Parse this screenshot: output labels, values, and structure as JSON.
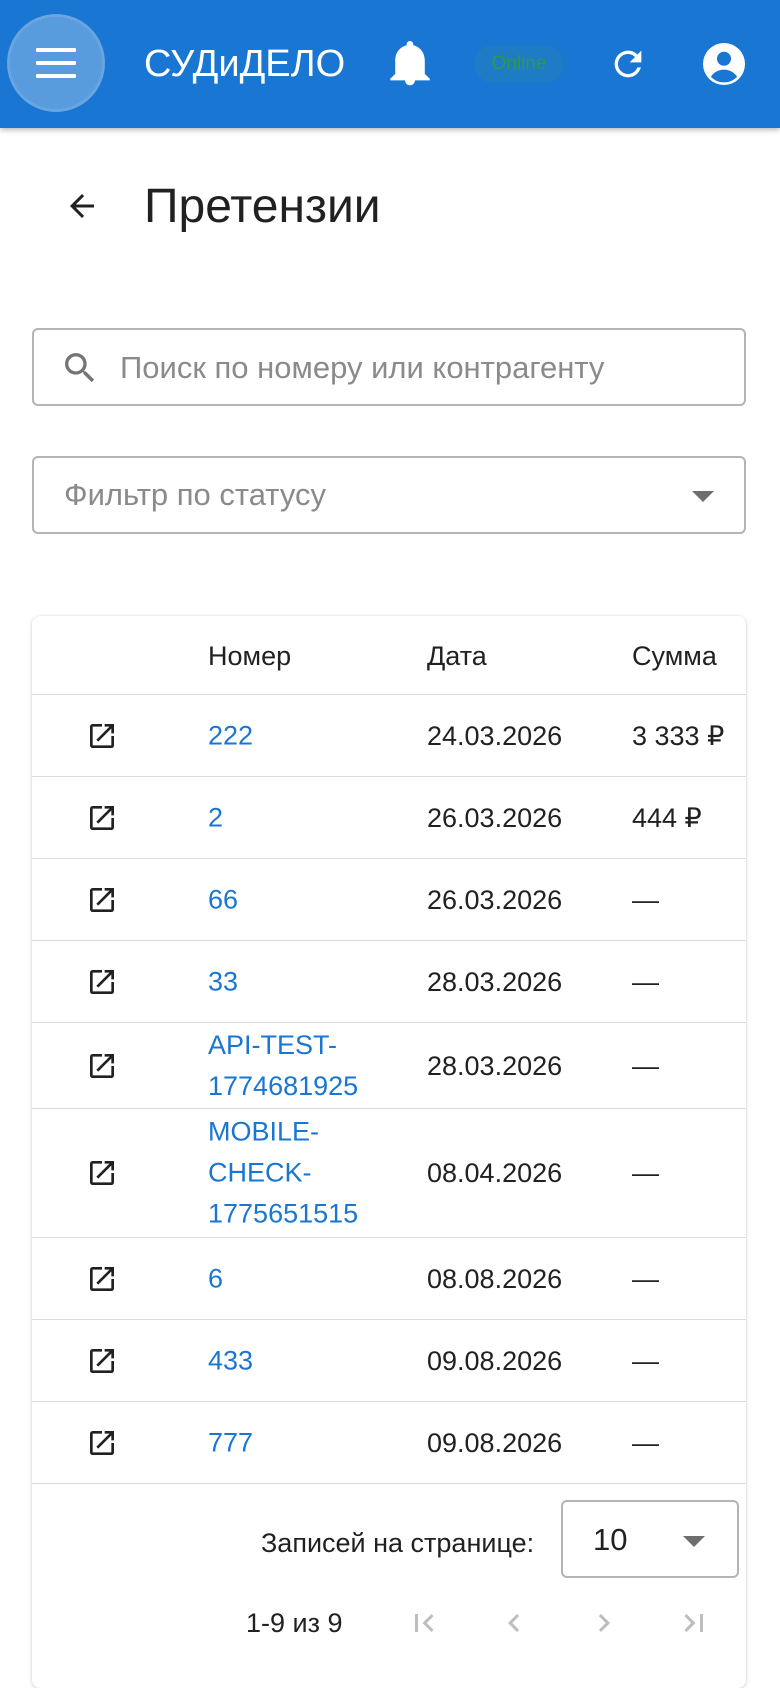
{
  "appbar": {
    "title": "СУДиДЕЛО",
    "status_badge": "Online",
    "colors": {
      "primary": "#1976d2",
      "badge_text": "#2e9a45"
    },
    "icons": [
      "menu-icon",
      "bell-icon",
      "refresh-icon",
      "account-icon"
    ]
  },
  "page": {
    "title": "Претензии",
    "back_icon": "arrow-left-icon"
  },
  "search": {
    "placeholder": "Поиск по номеру или контрагенту",
    "value": "",
    "icon": "search-icon"
  },
  "status_filter": {
    "placeholder": "Фильтр по статусу",
    "value": ""
  },
  "table": {
    "columns": [
      "",
      "Номер",
      "Дата",
      "Сумма"
    ],
    "rows": [
      {
        "number": "222",
        "date": "24.03.2026",
        "sum": "3 333 ₽"
      },
      {
        "number": "2",
        "date": "26.03.2026",
        "sum": "444 ₽"
      },
      {
        "number": "66",
        "date": "26.03.2026",
        "sum": "—"
      },
      {
        "number": "33",
        "date": "28.03.2026",
        "sum": "—"
      },
      {
        "number": "API-TEST-1774681925",
        "date": "28.03.2026",
        "sum": "—"
      },
      {
        "number": "MOBILE-CHECK-1775651515",
        "date": "08.04.2026",
        "sum": "—"
      },
      {
        "number": "6",
        "date": "08.08.2026",
        "sum": "—"
      },
      {
        "number": "433",
        "date": "09.08.2026",
        "sum": "—"
      },
      {
        "number": "777",
        "date": "09.08.2026",
        "sum": "—"
      }
    ],
    "row_icon": "open-in-new-icon"
  },
  "pagination": {
    "rows_per_page_label": "Записей на странице:",
    "rows_per_page": "10",
    "range": "1-9 из 9",
    "icons": [
      "first-page-icon",
      "prev-page-icon",
      "next-page-icon",
      "last-page-icon"
    ]
  }
}
